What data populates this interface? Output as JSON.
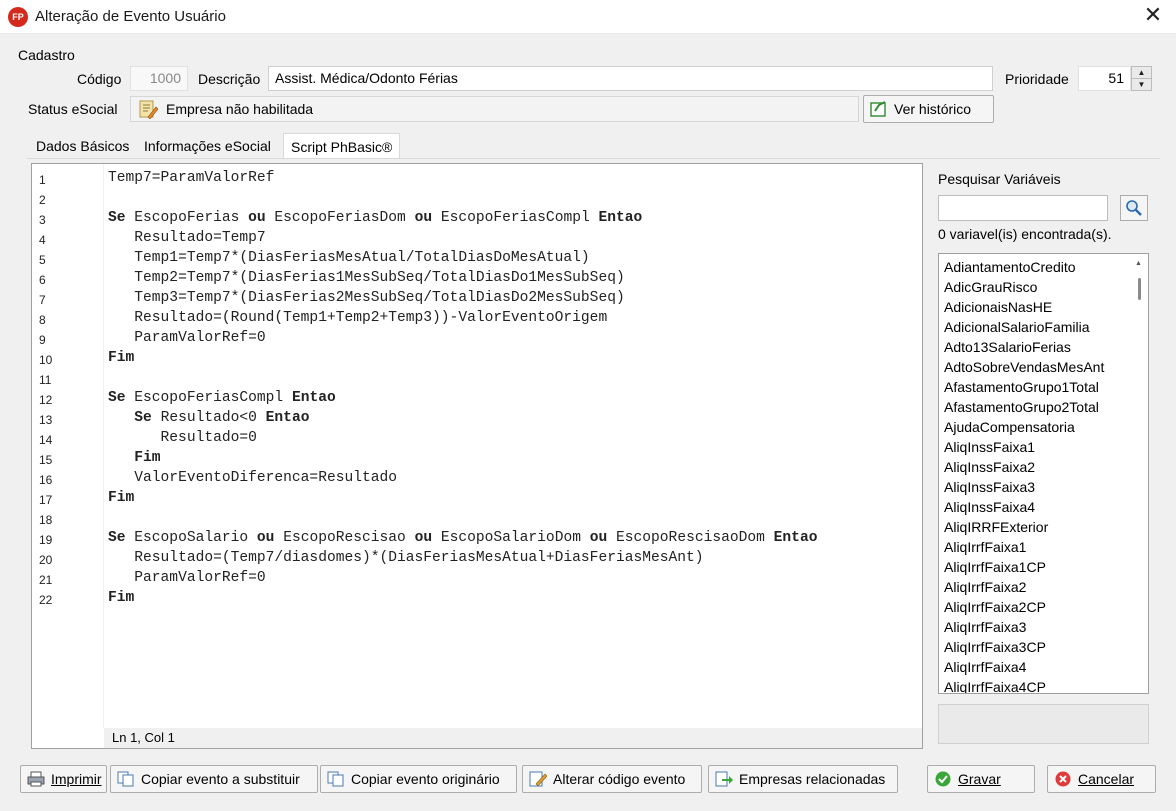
{
  "window": {
    "app_icon_text": "FP",
    "title": "Alteração de Evento Usuário",
    "close_glyph": "✕"
  },
  "cadastro": {
    "group_label": "Cadastro",
    "codigo_label": "Código",
    "codigo_value": "1000",
    "descricao_label": "Descrição",
    "descricao_value": "Assist. Médica/Odonto Férias",
    "prioridade_label": "Prioridade",
    "prioridade_value": "51",
    "status_label": "Status eSocial",
    "status_value": "Empresa não habilitada",
    "ver_historico_label": "Ver histórico"
  },
  "tabs": [
    {
      "label": "Dados Básicos"
    },
    {
      "label": "Informações eSocial"
    },
    {
      "label": "Script PhBasic®"
    }
  ],
  "editor": {
    "line_numbers": [
      "1",
      "2",
      "3",
      "4",
      "5",
      "6",
      "7",
      "8",
      "9",
      "10",
      "11",
      "12",
      "13",
      "14",
      "15",
      "16",
      "17",
      "18",
      "19",
      "20",
      "21",
      "22"
    ],
    "lines": [
      "Temp7=ParamValorRef",
      "",
      "Se EscopoFerias ou EscopoFeriasDom ou EscopoFeriasCompl Entao",
      "   Resultado=Temp7",
      "   Temp1=Temp7*(DiasFeriasMesAtual/TotalDiasDoMesAtual)",
      "   Temp2=Temp7*(DiasFerias1MesSubSeq/TotalDiasDo1MesSubSeq)",
      "   Temp3=Temp7*(DiasFerias2MesSubSeq/TotalDiasDo2MesSubSeq)",
      "   Resultado=(Round(Temp1+Temp2+Temp3))-ValorEventoOrigem",
      "   ParamValorRef=0",
      "Fim",
      "",
      "Se EscopoFeriasCompl Entao",
      "   Se Resultado<0 Entao",
      "      Resultado=0",
      "   Fim",
      "   ValorEventoDiferenca=Resultado",
      "Fim",
      "",
      "Se EscopoSalario ou EscopoRescisao ou EscopoSalarioDom ou EscopoRescisaoDom Entao",
      "   Resultado=(Temp7/diasdomes)*(DiasFeriasMesAtual+DiasFeriasMesAnt)",
      "   ParamValorRef=0",
      "Fim"
    ],
    "status_position": "Ln 1, Col 1"
  },
  "variables": {
    "title": "Pesquisar Variáveis",
    "search_value": "",
    "count_text": "0 variavel(is) encontrada(s).",
    "items": [
      "AdiantamentoCredito",
      "AdicGrauRisco",
      "AdicionaisNasHE",
      "AdicionalSalarioFamilia",
      "Adto13SalarioFerias",
      "AdtoSobreVendasMesAnt",
      "AfastamentoGrupo1Total",
      "AfastamentoGrupo2Total",
      "AjudaCompensatoria",
      "AliqInssFaixa1",
      "AliqInssFaixa2",
      "AliqInssFaixa3",
      "AliqInssFaixa4",
      "AliqIRRFExterior",
      "AliqIrrfFaixa1",
      "AliqIrrfFaixa1CP",
      "AliqIrrfFaixa2",
      "AliqIrrfFaixa2CP",
      "AliqIrrfFaixa3",
      "AliqIrrfFaixa3CP",
      "AliqIrrfFaixa4",
      "AliqIrrfFaixa4CP"
    ]
  },
  "footer": {
    "imprimir": "Imprimir",
    "copiar_substituir": "Copiar evento a substituir",
    "copiar_originario": "Copiar evento originário",
    "alterar_codigo": "Alterar código evento",
    "empresas_relacionadas": "Empresas relacionadas",
    "gravar": "Gravar",
    "cancelar": "Cancelar"
  },
  "keywords": [
    "Se",
    "ou",
    "Entao",
    "Fim"
  ],
  "colors": {
    "accent": "#d42a1e",
    "ok_green": "#3aa63a",
    "cancel_red": "#e03a3a"
  }
}
